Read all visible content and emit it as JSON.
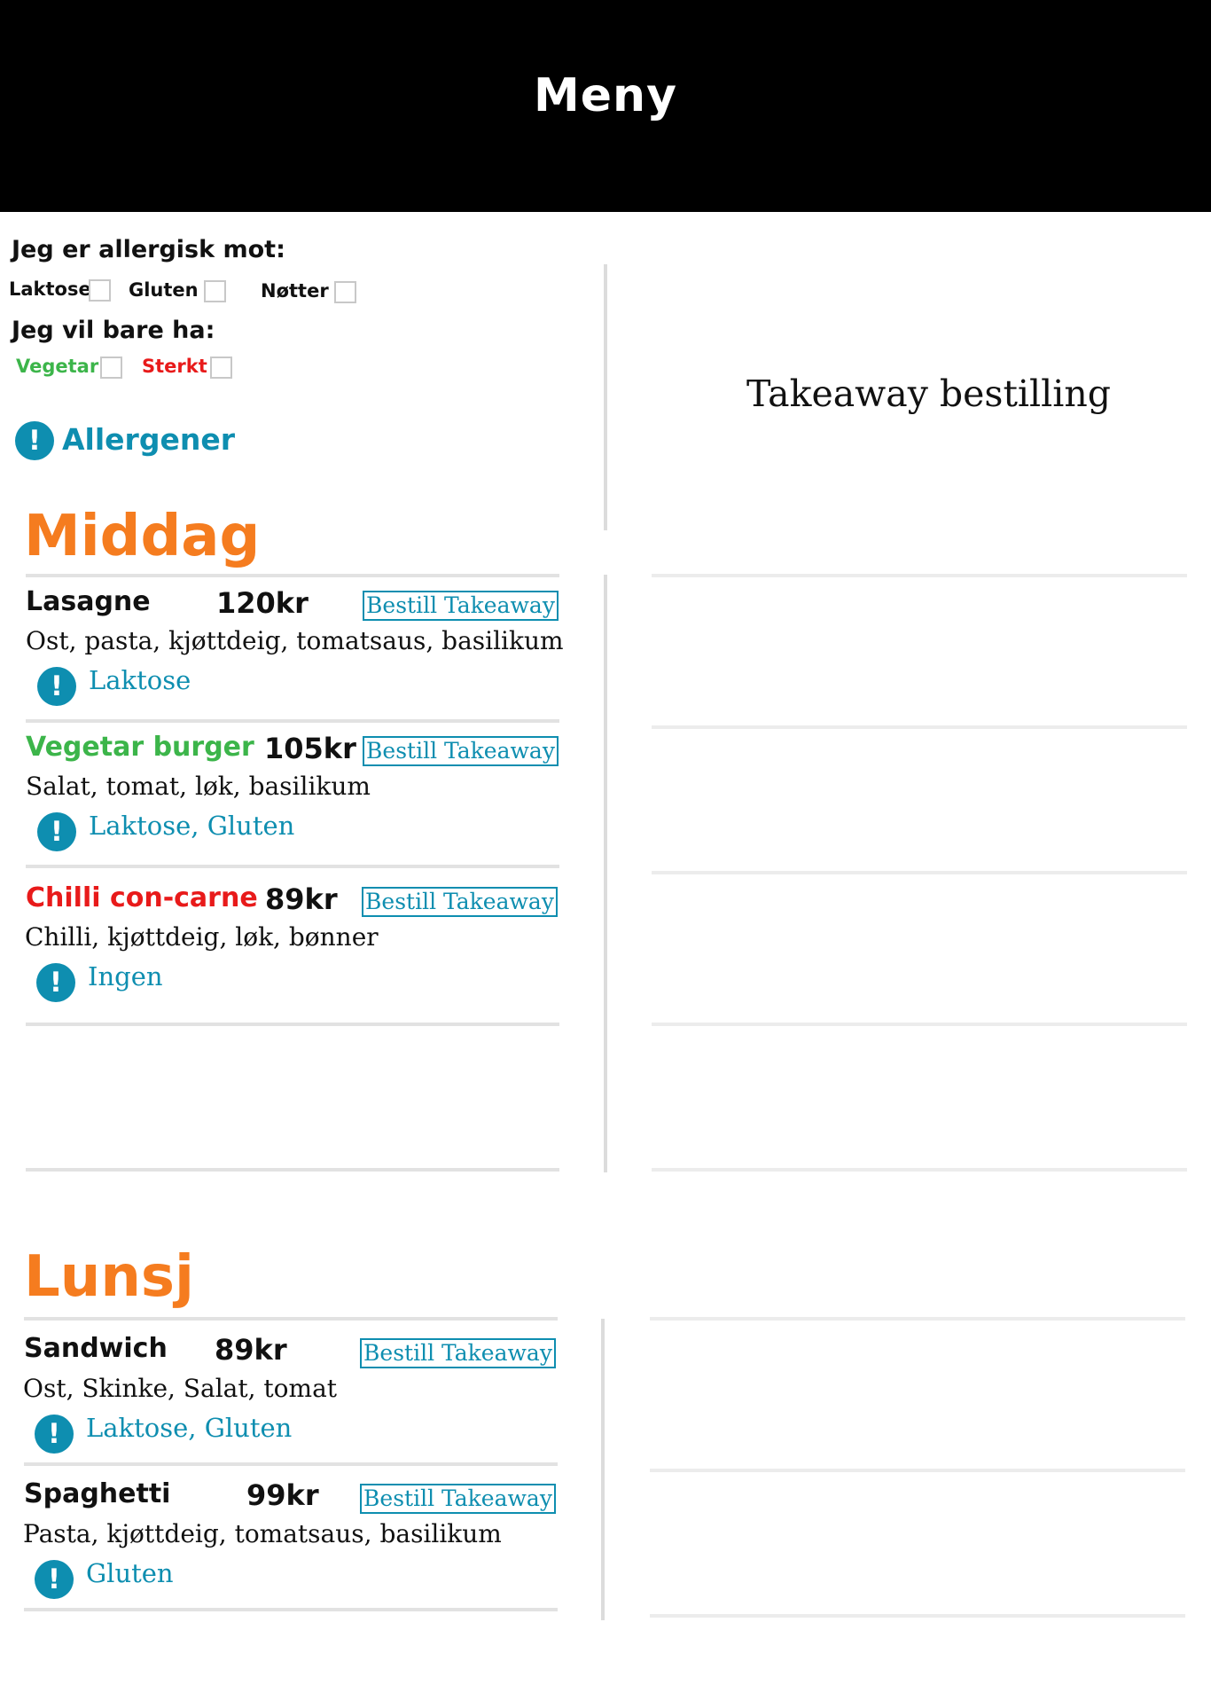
{
  "header": {
    "title": "Meny"
  },
  "filters": {
    "allergy_heading": "Jeg er allergisk mot:",
    "allergy_options": [
      {
        "label": "Laktose",
        "checked": false
      },
      {
        "label": "Gluten",
        "checked": false
      },
      {
        "label": "Nøtter",
        "checked": false
      }
    ],
    "preference_heading": "Jeg vil bare ha:",
    "preference_options": [
      {
        "label": "Vegetar",
        "color": "#3cb54a",
        "checked": false
      },
      {
        "label": "Sterkt",
        "color": "#e81a1a",
        "checked": false
      }
    ]
  },
  "allergen_link": {
    "label": "Allergener"
  },
  "takeaway": {
    "title": "Takeaway bestilling"
  },
  "sections": [
    {
      "title": "Middag",
      "items": [
        {
          "name": "Lasagne",
          "name_color": "#111111",
          "price": "120kr",
          "button": "Bestill Takeaway",
          "description": "Ost, pasta, kjøttdeig, tomatsaus, basilikum",
          "allergens": "Laktose"
        },
        {
          "name": "Vegetar burger",
          "name_color": "#3cb54a",
          "price": "105kr",
          "button": "Bestill Takeaway",
          "description": "Salat, tomat, løk, basilikum",
          "allergens": "Laktose, Gluten"
        },
        {
          "name": "Chilli con-carne",
          "name_color": "#e81a1a",
          "price": "89kr",
          "button": "Bestill Takeaway",
          "description": "Chilli, kjøttdeig, løk, bønner",
          "allergens": "Ingen"
        }
      ]
    },
    {
      "title": "Lunsj",
      "items": [
        {
          "name": "Sandwich",
          "name_color": "#111111",
          "price": "89kr",
          "button": "Bestill Takeaway",
          "description": "Ost, Skinke, Salat, tomat",
          "allergens": "Laktose, Gluten"
        },
        {
          "name": "Spaghetti",
          "name_color": "#111111",
          "price": "99kr",
          "button": "Bestill Takeaway",
          "description": "Pasta, kjøttdeig, tomatsaus, basilikum",
          "allergens": "Gluten"
        }
      ]
    }
  ],
  "colors": {
    "accent": "#0e8eb0",
    "section": "#f57c1f",
    "header_bg": "#000000"
  }
}
